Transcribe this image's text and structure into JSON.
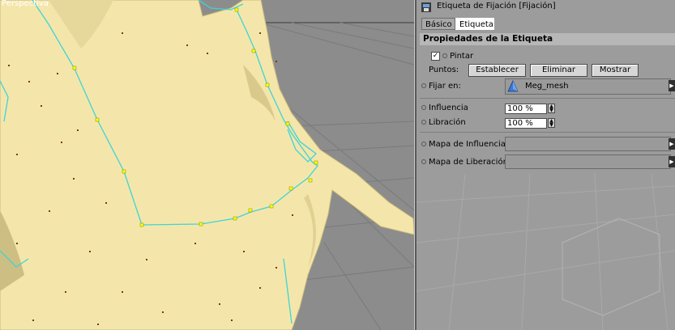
{
  "viewport": {
    "label": "Perspectiva"
  },
  "panel": {
    "title": "Etiqueta de Fijación [Fijación]",
    "tabs": [
      {
        "label": "Básico",
        "active": false
      },
      {
        "label": "Etiqueta",
        "active": true
      }
    ],
    "section_title": "Propiedades de la Etiqueta",
    "pintar": {
      "label": "Pintar",
      "checked": true
    },
    "puntos": {
      "label": "Puntos:",
      "buttons": [
        "Establecer",
        "Eliminar",
        "Mostrar"
      ]
    },
    "fijar_en": {
      "label": "Fijar en:",
      "object": "Meg_mesh"
    },
    "influencia": {
      "label": "Influencia",
      "value": "100 %"
    },
    "libracion": {
      "label": "Libración",
      "value": "100 %"
    },
    "mapa_influencia": {
      "label": "Mapa de Influencia",
      "value": ""
    },
    "mapa_liberacion": {
      "label": "Mapa de Liberación",
      "value": ""
    }
  },
  "colors": {
    "mesh_skin": "#f4e6ab",
    "wire_cyan": "#3fd4d4",
    "point_yellow": "#ffff00",
    "vertex_dot": "#7a3a10",
    "panel_bg": "#9c9c9c",
    "section_header_bg": "#b7b7b7"
  }
}
